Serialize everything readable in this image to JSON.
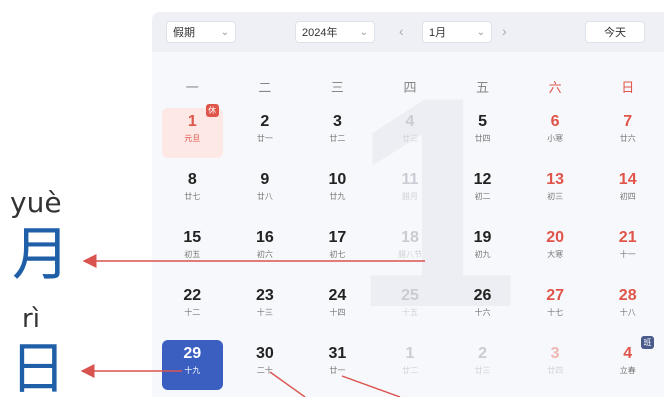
{
  "annotation": {
    "month_pinyin": "yuè",
    "month_hanzi": "月",
    "day_pinyin": "rì",
    "day_hanzi": "日"
  },
  "toolbar": {
    "holiday_label": "假期",
    "year_value": "2024年",
    "month_value": "1月",
    "today_label": "今天"
  },
  "background_month": "1",
  "weekdays": [
    "一",
    "二",
    "三",
    "四",
    "五",
    "六",
    "日"
  ],
  "colors": {
    "accent": "#3b5fc0",
    "weekend": "#e0554a",
    "annotation": "#1f5fa8"
  },
  "days": [
    {
      "num": "1",
      "lunar": "元旦",
      "holiday": true,
      "badge": "休"
    },
    {
      "num": "2",
      "lunar": "廿一"
    },
    {
      "num": "3",
      "lunar": "廿二"
    },
    {
      "num": "4",
      "lunar": "廿三",
      "other": true
    },
    {
      "num": "5",
      "lunar": "廿四"
    },
    {
      "num": "6",
      "lunar": "小寒",
      "weekend": true
    },
    {
      "num": "7",
      "lunar": "廿六",
      "weekend": true
    },
    {
      "num": "8",
      "lunar": "廿七"
    },
    {
      "num": "9",
      "lunar": "廿八"
    },
    {
      "num": "10",
      "lunar": "廿九"
    },
    {
      "num": "11",
      "lunar": "腊月",
      "other": true
    },
    {
      "num": "12",
      "lunar": "初二"
    },
    {
      "num": "13",
      "lunar": "初三",
      "weekend": true
    },
    {
      "num": "14",
      "lunar": "初四",
      "weekend": true
    },
    {
      "num": "15",
      "lunar": "初五"
    },
    {
      "num": "16",
      "lunar": "初六"
    },
    {
      "num": "17",
      "lunar": "初七"
    },
    {
      "num": "18",
      "lunar": "腊八节",
      "other": true
    },
    {
      "num": "19",
      "lunar": "初九"
    },
    {
      "num": "20",
      "lunar": "大寒",
      "weekend": true
    },
    {
      "num": "21",
      "lunar": "十一",
      "weekend": true
    },
    {
      "num": "22",
      "lunar": "十二"
    },
    {
      "num": "23",
      "lunar": "十三"
    },
    {
      "num": "24",
      "lunar": "十四"
    },
    {
      "num": "25",
      "lunar": "十五",
      "other": true
    },
    {
      "num": "26",
      "lunar": "十六"
    },
    {
      "num": "27",
      "lunar": "十七",
      "weekend": true
    },
    {
      "num": "28",
      "lunar": "十八",
      "weekend": true
    },
    {
      "num": "29",
      "lunar": "十九",
      "selected": true
    },
    {
      "num": "30",
      "lunar": "二十"
    },
    {
      "num": "31",
      "lunar": "廿一"
    },
    {
      "num": "1",
      "lunar": "廿二",
      "other": true
    },
    {
      "num": "2",
      "lunar": "廿三",
      "other": true
    },
    {
      "num": "3",
      "lunar": "廿四",
      "other": true,
      "weekend": true
    },
    {
      "num": "4",
      "lunar": "立春",
      "badge": "班"
    }
  ]
}
